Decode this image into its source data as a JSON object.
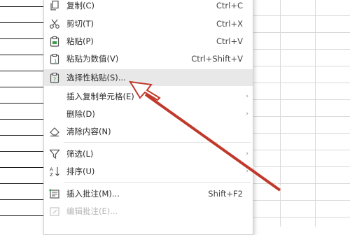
{
  "menu": {
    "items": [
      {
        "label": "复制(C)",
        "shortcut": "Ctrl+C",
        "icon": "copy-icon"
      },
      {
        "label": "剪切(T)",
        "shortcut": "Ctrl+X",
        "icon": "scissors-icon"
      },
      {
        "label": "粘贴(P)",
        "shortcut": "Ctrl+V",
        "icon": "paste-icon"
      },
      {
        "label": "粘贴为数值(V)",
        "shortcut": "Ctrl+Shift+V",
        "icon": "paste-values-icon"
      },
      {
        "label": "选择性粘贴(S)...",
        "shortcut": "",
        "icon": "paste-special-icon",
        "highlighted": true
      },
      {
        "label": "插入复制单元格(E)",
        "submenu_arrow": "›"
      },
      {
        "label": "删除(D)",
        "submenu_arrow": "›"
      },
      {
        "label": "清除内容(N)",
        "icon": "eraser-icon"
      },
      {
        "label": "筛选(L)",
        "icon": "filter-icon",
        "submenu_arrow": "›"
      },
      {
        "label": "排序(U)",
        "icon": "sort-az-icon",
        "submenu_arrow": "›"
      },
      {
        "label": "插入批注(M)...",
        "shortcut": "Shift+F2",
        "icon": "insert-comment-icon"
      },
      {
        "label": "编辑批注(E)...",
        "icon": "edit-comment-icon",
        "disabled": true
      }
    ]
  },
  "colors": {
    "arrow": "#c0392b",
    "highlight": "#e8e8e8"
  }
}
